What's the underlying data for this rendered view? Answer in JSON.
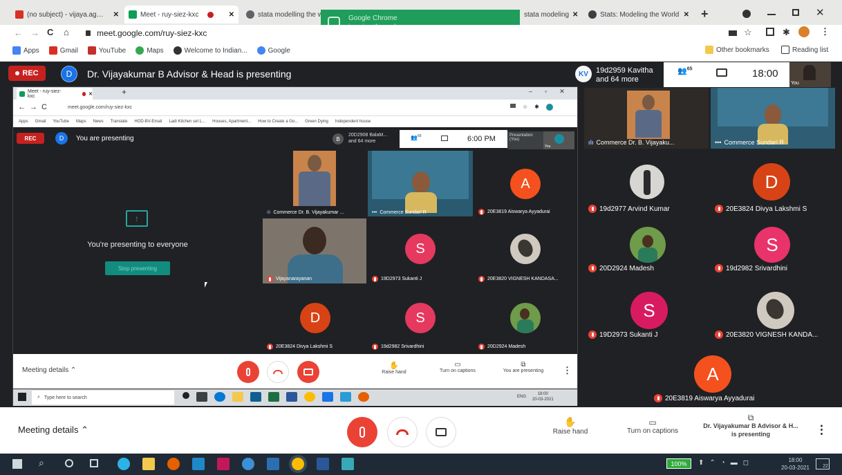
{
  "browser": {
    "tabs": [
      {
        "title": "(no subject) - vijaya.ag@gm",
        "color": "#d93025"
      },
      {
        "title": "Meet - ruy-siez-kxc",
        "color": "#0f9d58"
      },
      {
        "title": "",
        "color": "#c5221f"
      },
      {
        "title": "stata modelling the w",
        "color": "#5f6368"
      },
      {
        "title": "stata modeling",
        "color": "#5f6368"
      },
      {
        "title": "Stats: Modeling the World",
        "color": "#3c4043"
      }
    ],
    "url": "meet.google.com/ruy-siez-kxc",
    "bookmarks": [
      "Apps",
      "Gmail",
      "YouTube",
      "Maps",
      "Welcome to Indian...",
      "Google"
    ],
    "other_bookmarks": "Other bookmarks",
    "reading_list": "Reading list",
    "toast": {
      "line1": "Google Chrome",
      "line2": "is using the webcam"
    }
  },
  "meet": {
    "rec": "REC",
    "presenter_initial": "D",
    "presenter_banner": "Dr. Vijayakumar B Advisor & Head is presenting",
    "participants_initials": "KV",
    "participants_line1": "19d2959 Kavitha",
    "participants_line2": "and 64 more",
    "people_count": "65",
    "clock": "18:00",
    "self_label": "You",
    "right_tiles": [
      {
        "name": "Commerce Dr. B. Vijayaku...",
        "type": "video"
      },
      {
        "name": "Commerce Sundari R",
        "type": "video"
      }
    ],
    "right_grid": [
      {
        "name": "19d2977 Arvind Kumar",
        "initial": "",
        "color": ""
      },
      {
        "name": "20E3824 Divya Lakshmi S",
        "initial": "D",
        "color": "#d84315"
      },
      {
        "name": "20D2924 Madesh",
        "initial": "",
        "color": ""
      },
      {
        "name": "19d2982 Srivardhini",
        "initial": "S",
        "color": "#e8336b"
      },
      {
        "name": "19D2973 Sukanti J",
        "initial": "S",
        "color": "#d81b60"
      },
      {
        "name": "20E3820 VIGNESH KANDA...",
        "initial": "",
        "color": ""
      },
      {
        "name": "20E3819 Aiswarya Ayyadurai",
        "initial": "A",
        "color": "#f4511e"
      }
    ],
    "bottom": {
      "meeting_details": "Meeting details",
      "raise_hand": "Raise hand",
      "captions": "Turn on captions",
      "presenting_line1": "Dr. Vijayakumar B Advisor & H...",
      "presenting_line2": "is presenting"
    }
  },
  "shared": {
    "tab_title": "Meet - ruy-siez-kxc",
    "url": "meet.google.com/ruy-siez-kxc",
    "bookmarks": [
      "Apps",
      "Gmail",
      "YouTube",
      "Maps",
      "News",
      "Translate",
      "HOD-BV-Email",
      "Ladi Kitchen set L...",
      "Houses, Apartment...",
      "How to Create a Go...",
      "Green Dying",
      "Independent house"
    ],
    "rec": "REC",
    "initial": "D",
    "banner": "You are presenting",
    "participants_initial": "B",
    "participants_line1": "20D2908 BalaM...",
    "participants_line2": "and 64 more",
    "people_count": "65",
    "clock": "6:00 PM",
    "thumb_label": "Presentation (You)",
    "self_label": "You",
    "presenting_to": "You're presenting to everyone",
    "stop_button": "Stop presenting",
    "tiles": [
      {
        "name": "Commerce Dr. B. Vijayakumar ...",
        "initial": "",
        "color": ""
      },
      {
        "name": "Commerce Sundari R",
        "initial": "",
        "color": ""
      },
      {
        "name": "20E3819 Aiswarya Ayyadurai",
        "initial": "A",
        "color": "#f4511e"
      },
      {
        "name": "Vijayanarayanan",
        "initial": "",
        "color": ""
      },
      {
        "name": "19D2973 Sukanti J",
        "initial": "S",
        "color": "#e53960"
      },
      {
        "name": "20E3820 VIGNESH KANDASA...",
        "initial": "",
        "color": ""
      },
      {
        "name": "20E3824 Divya Lakshmi S",
        "initial": "D",
        "color": "#d84315"
      },
      {
        "name": "19d2982 Srivardhini",
        "initial": "S",
        "color": "#e53960"
      },
      {
        "name": "20D2924 Madesh",
        "initial": "",
        "color": ""
      }
    ],
    "bottom": {
      "meeting_details": "Meeting details",
      "raise_hand": "Raise hand",
      "captions": "Turn on captions",
      "presenting": "You are presenting"
    },
    "taskbar": {
      "search": "Type here to search",
      "time": "18:00",
      "date": "20-03-2021",
      "lang": "ENG"
    }
  },
  "taskbar": {
    "battery": "100%",
    "time": "18:00",
    "date": "20-03-2021",
    "notif": "22"
  }
}
